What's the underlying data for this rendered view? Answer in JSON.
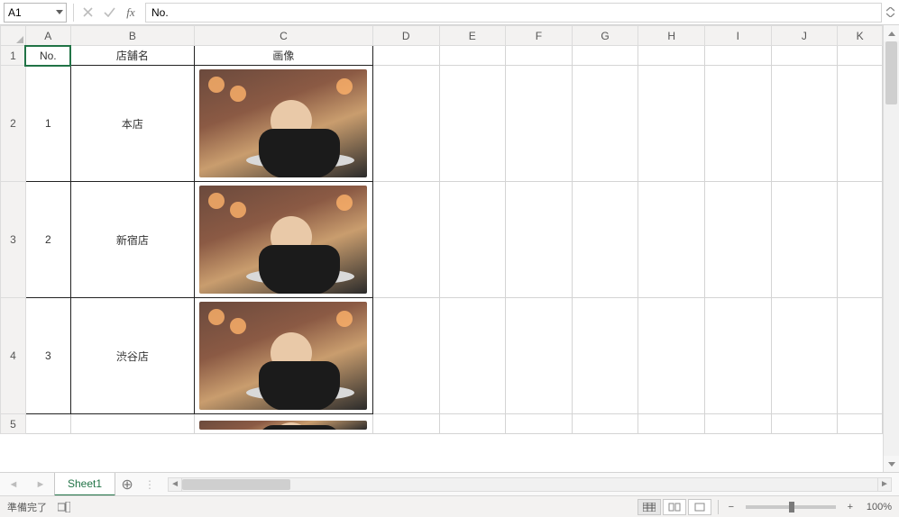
{
  "nameBox": {
    "value": "A1"
  },
  "formulaBar": {
    "value": "No."
  },
  "columns": [
    "A",
    "B",
    "C",
    "D",
    "E",
    "F",
    "G",
    "H",
    "I",
    "J",
    "K"
  ],
  "headerRow": {
    "rownum": "1",
    "a": "No.",
    "b": "店舗名",
    "c": "画像"
  },
  "rows": [
    {
      "rownum": "2",
      "no": "1",
      "store": "本店"
    },
    {
      "rownum": "3",
      "no": "2",
      "store": "新宿店"
    },
    {
      "rownum": "4",
      "no": "3",
      "store": "渋谷店"
    }
  ],
  "extraRow": {
    "rownum": "5"
  },
  "sheetTab": {
    "name": "Sheet1"
  },
  "statusBar": {
    "ready": "準備完了",
    "zoom": "100%"
  }
}
